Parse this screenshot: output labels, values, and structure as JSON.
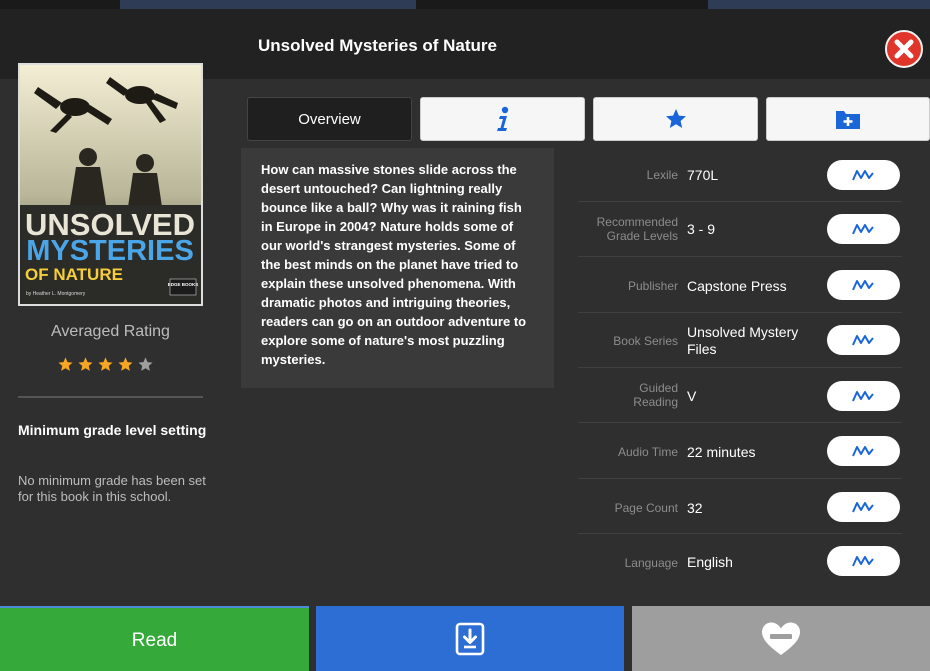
{
  "book": {
    "title": "Unsolved Mysteries of Nature",
    "cover": {
      "line1": "UNSOLVED",
      "line2": "MYSTERIES",
      "line3": "OF NATURE",
      "author": "by Heather L. Montgomery",
      "imprint": "EDGE BOOKS"
    },
    "description": "How can massive stones slide across the desert untouched? Can lightning really bounce like a ball? Why was it raining fish in Europe in 2004? Nature holds some of our world's strangest mysteries. Some of the best minds on the planet have tried to explain these unsolved phenomena. With dramatic photos and intriguing theories, readers can go on an outdoor adventure to explore some of nature's most puzzling mysteries."
  },
  "rating": {
    "label": "Averaged Rating",
    "value": 4,
    "max": 5,
    "color_filled": "#f5a623",
    "color_empty": "#9e9e9e"
  },
  "min_grade": {
    "title": "Minimum grade level setting",
    "description": "No minimum grade has been set for this book in this school."
  },
  "tabs": [
    {
      "label": "Overview",
      "icon": "",
      "active": true
    },
    {
      "label": "",
      "icon": "info-icon",
      "active": false
    },
    {
      "label": "",
      "icon": "star-icon",
      "active": false
    },
    {
      "label": "",
      "icon": "folder-add-icon",
      "active": false
    }
  ],
  "metadata": [
    {
      "label": "Lexile",
      "value": "770L"
    },
    {
      "label": "Recommended Grade Levels",
      "value": "3 - 9"
    },
    {
      "label": "Publisher",
      "value": "Capstone Press"
    },
    {
      "label": "Book Series",
      "value": "Unsolved Mystery Files"
    },
    {
      "label": "Guided Reading",
      "value": "V"
    },
    {
      "label": "Audio Time",
      "value": "22 minutes"
    },
    {
      "label": "Page Count",
      "value": "32"
    },
    {
      "label": "Language",
      "value": "English"
    }
  ],
  "meta_button_icon": "related-books-icon",
  "actions": {
    "read": "Read",
    "download_icon": "download-icon",
    "favorite_icon": "heart-remove-icon"
  },
  "colors": {
    "read": "#35a93a",
    "download": "#2d6ed5",
    "favorite": "#9e9e9e",
    "close": "#e0352b",
    "accent_blue": "#1a66d9"
  }
}
